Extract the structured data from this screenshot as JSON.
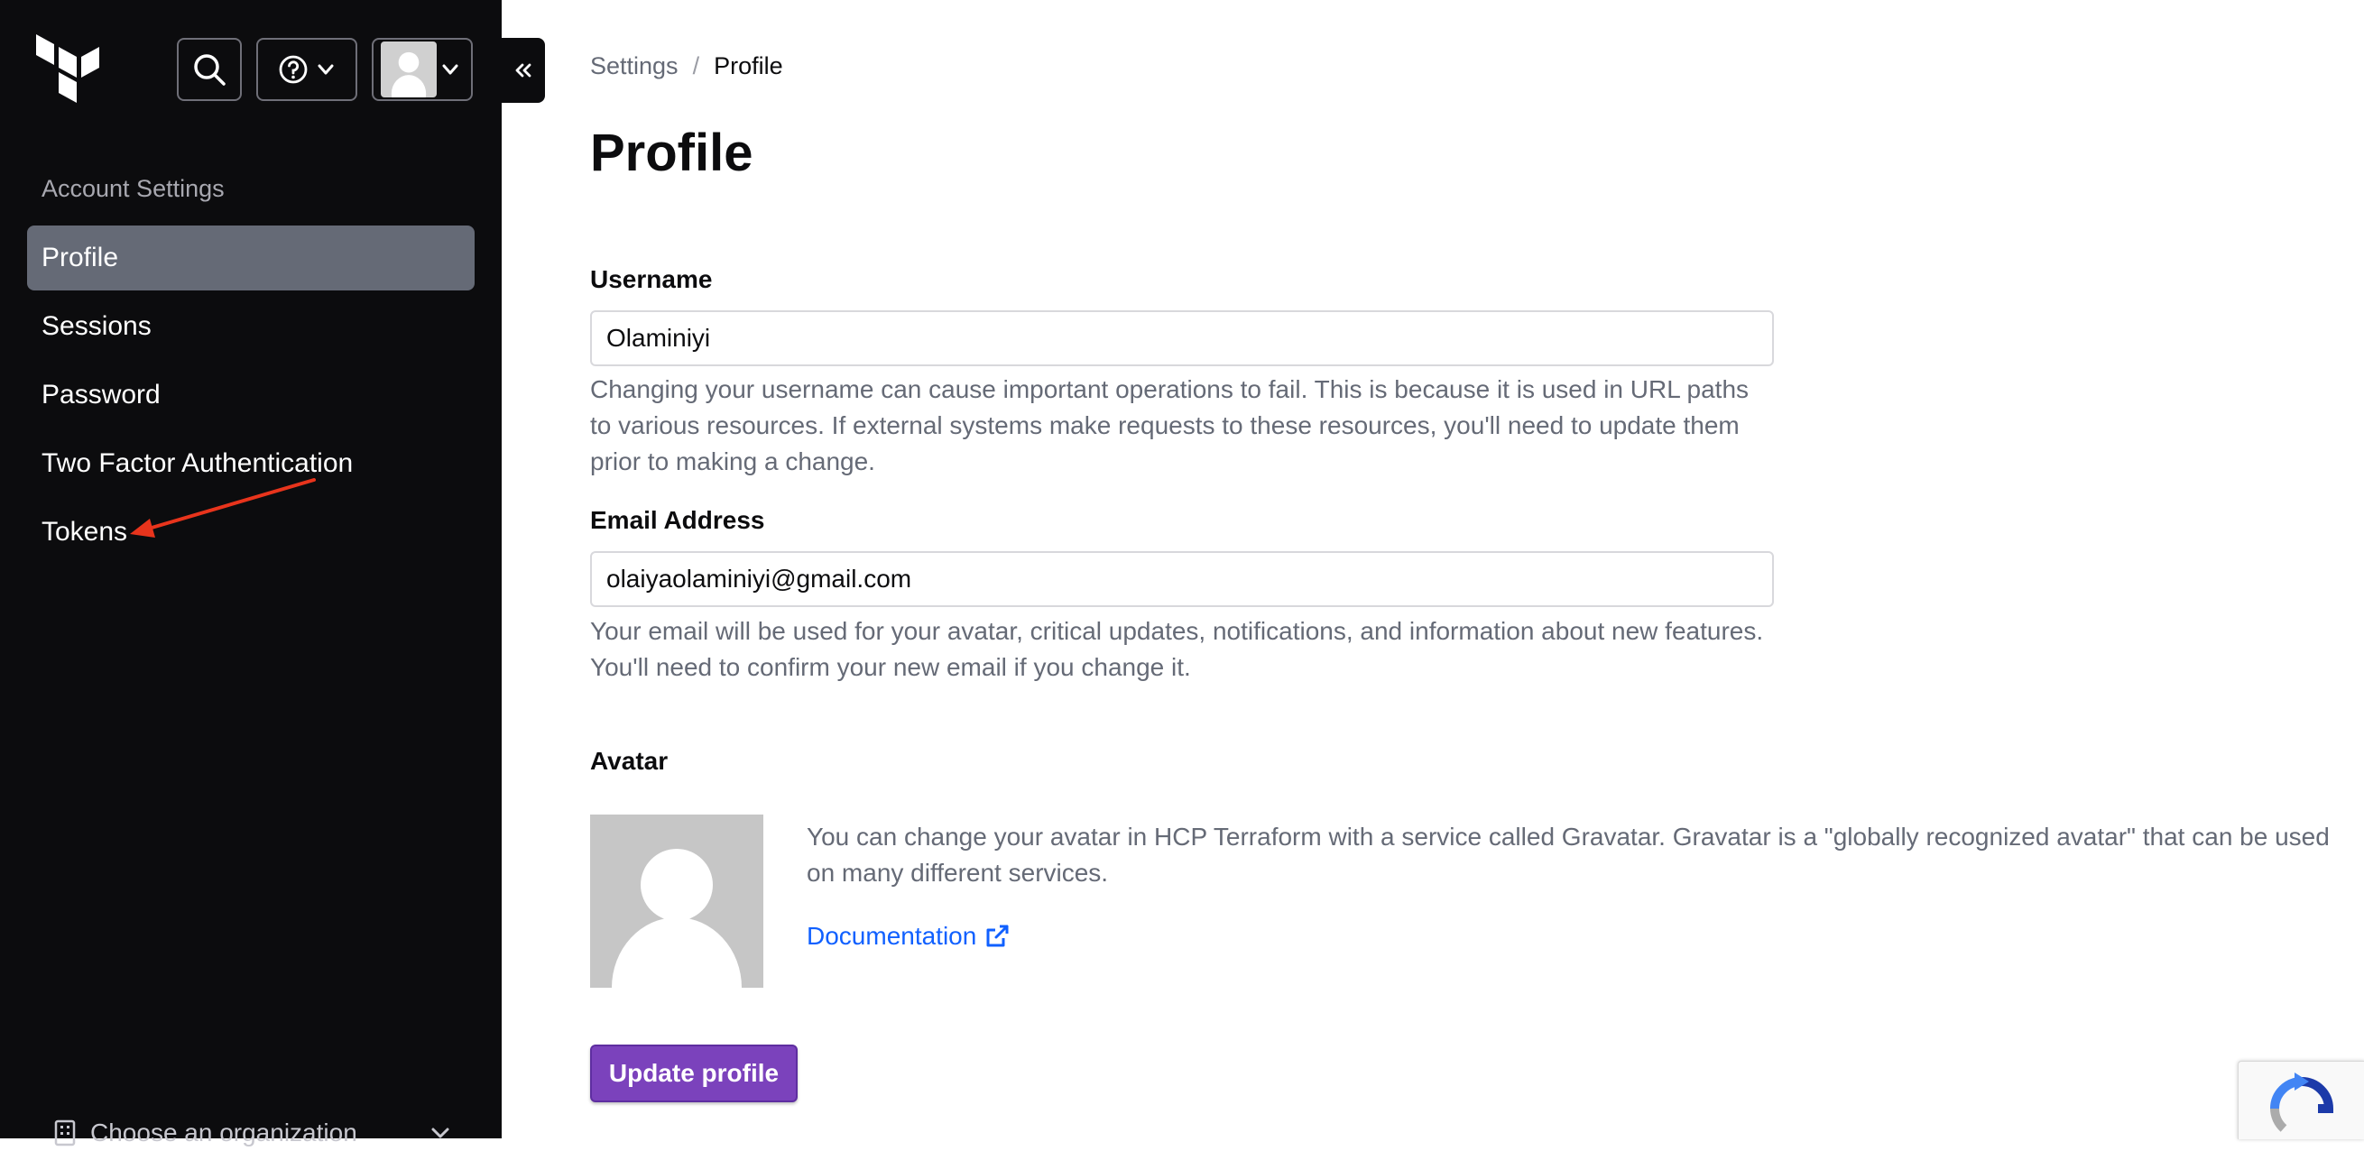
{
  "colors": {
    "sidebar_bg": "#0c0c0e",
    "active_item_bg": "#656a76",
    "link": "#1060ff",
    "primary_button": "#7b42bc",
    "annotation_arrow": "#e8341c"
  },
  "header": {
    "icons": [
      "terraform-logo",
      "search-icon",
      "help-icon",
      "chevron-down-icon",
      "user-avatar",
      "collapse-icon"
    ]
  },
  "sidebar": {
    "section_title": "Account Settings",
    "items": [
      {
        "label": "Profile",
        "active": true
      },
      {
        "label": "Sessions",
        "active": false
      },
      {
        "label": "Password",
        "active": false
      },
      {
        "label": "Two Factor Authentication",
        "active": false
      },
      {
        "label": "Tokens",
        "active": false
      }
    ],
    "org_chooser": {
      "label": "Choose an organization",
      "icon": "building-icon"
    }
  },
  "breadcrumb": {
    "parent": "Settings",
    "separator": "/",
    "current": "Profile"
  },
  "main": {
    "title": "Profile",
    "username": {
      "label": "Username",
      "value": "Olaminiyi",
      "help": "Changing your username can cause important operations to fail. This is because it is used in URL paths to various resources. If external systems make requests to these resources, you'll need to update them prior to making a change."
    },
    "email": {
      "label": "Email Address",
      "value": "olaiyaolaminiyi@gmail.com",
      "help": "Your email will be used for your avatar, critical updates, notifications, and information about new features. You'll need to confirm your new email if you change it."
    },
    "avatar": {
      "label": "Avatar",
      "description": "You can change your avatar in HCP Terraform with a service called Gravatar. Gravatar is a \"globally recognized avatar\" that can be used on many different services.",
      "link_label": "Documentation"
    },
    "submit_label": "Update profile"
  }
}
